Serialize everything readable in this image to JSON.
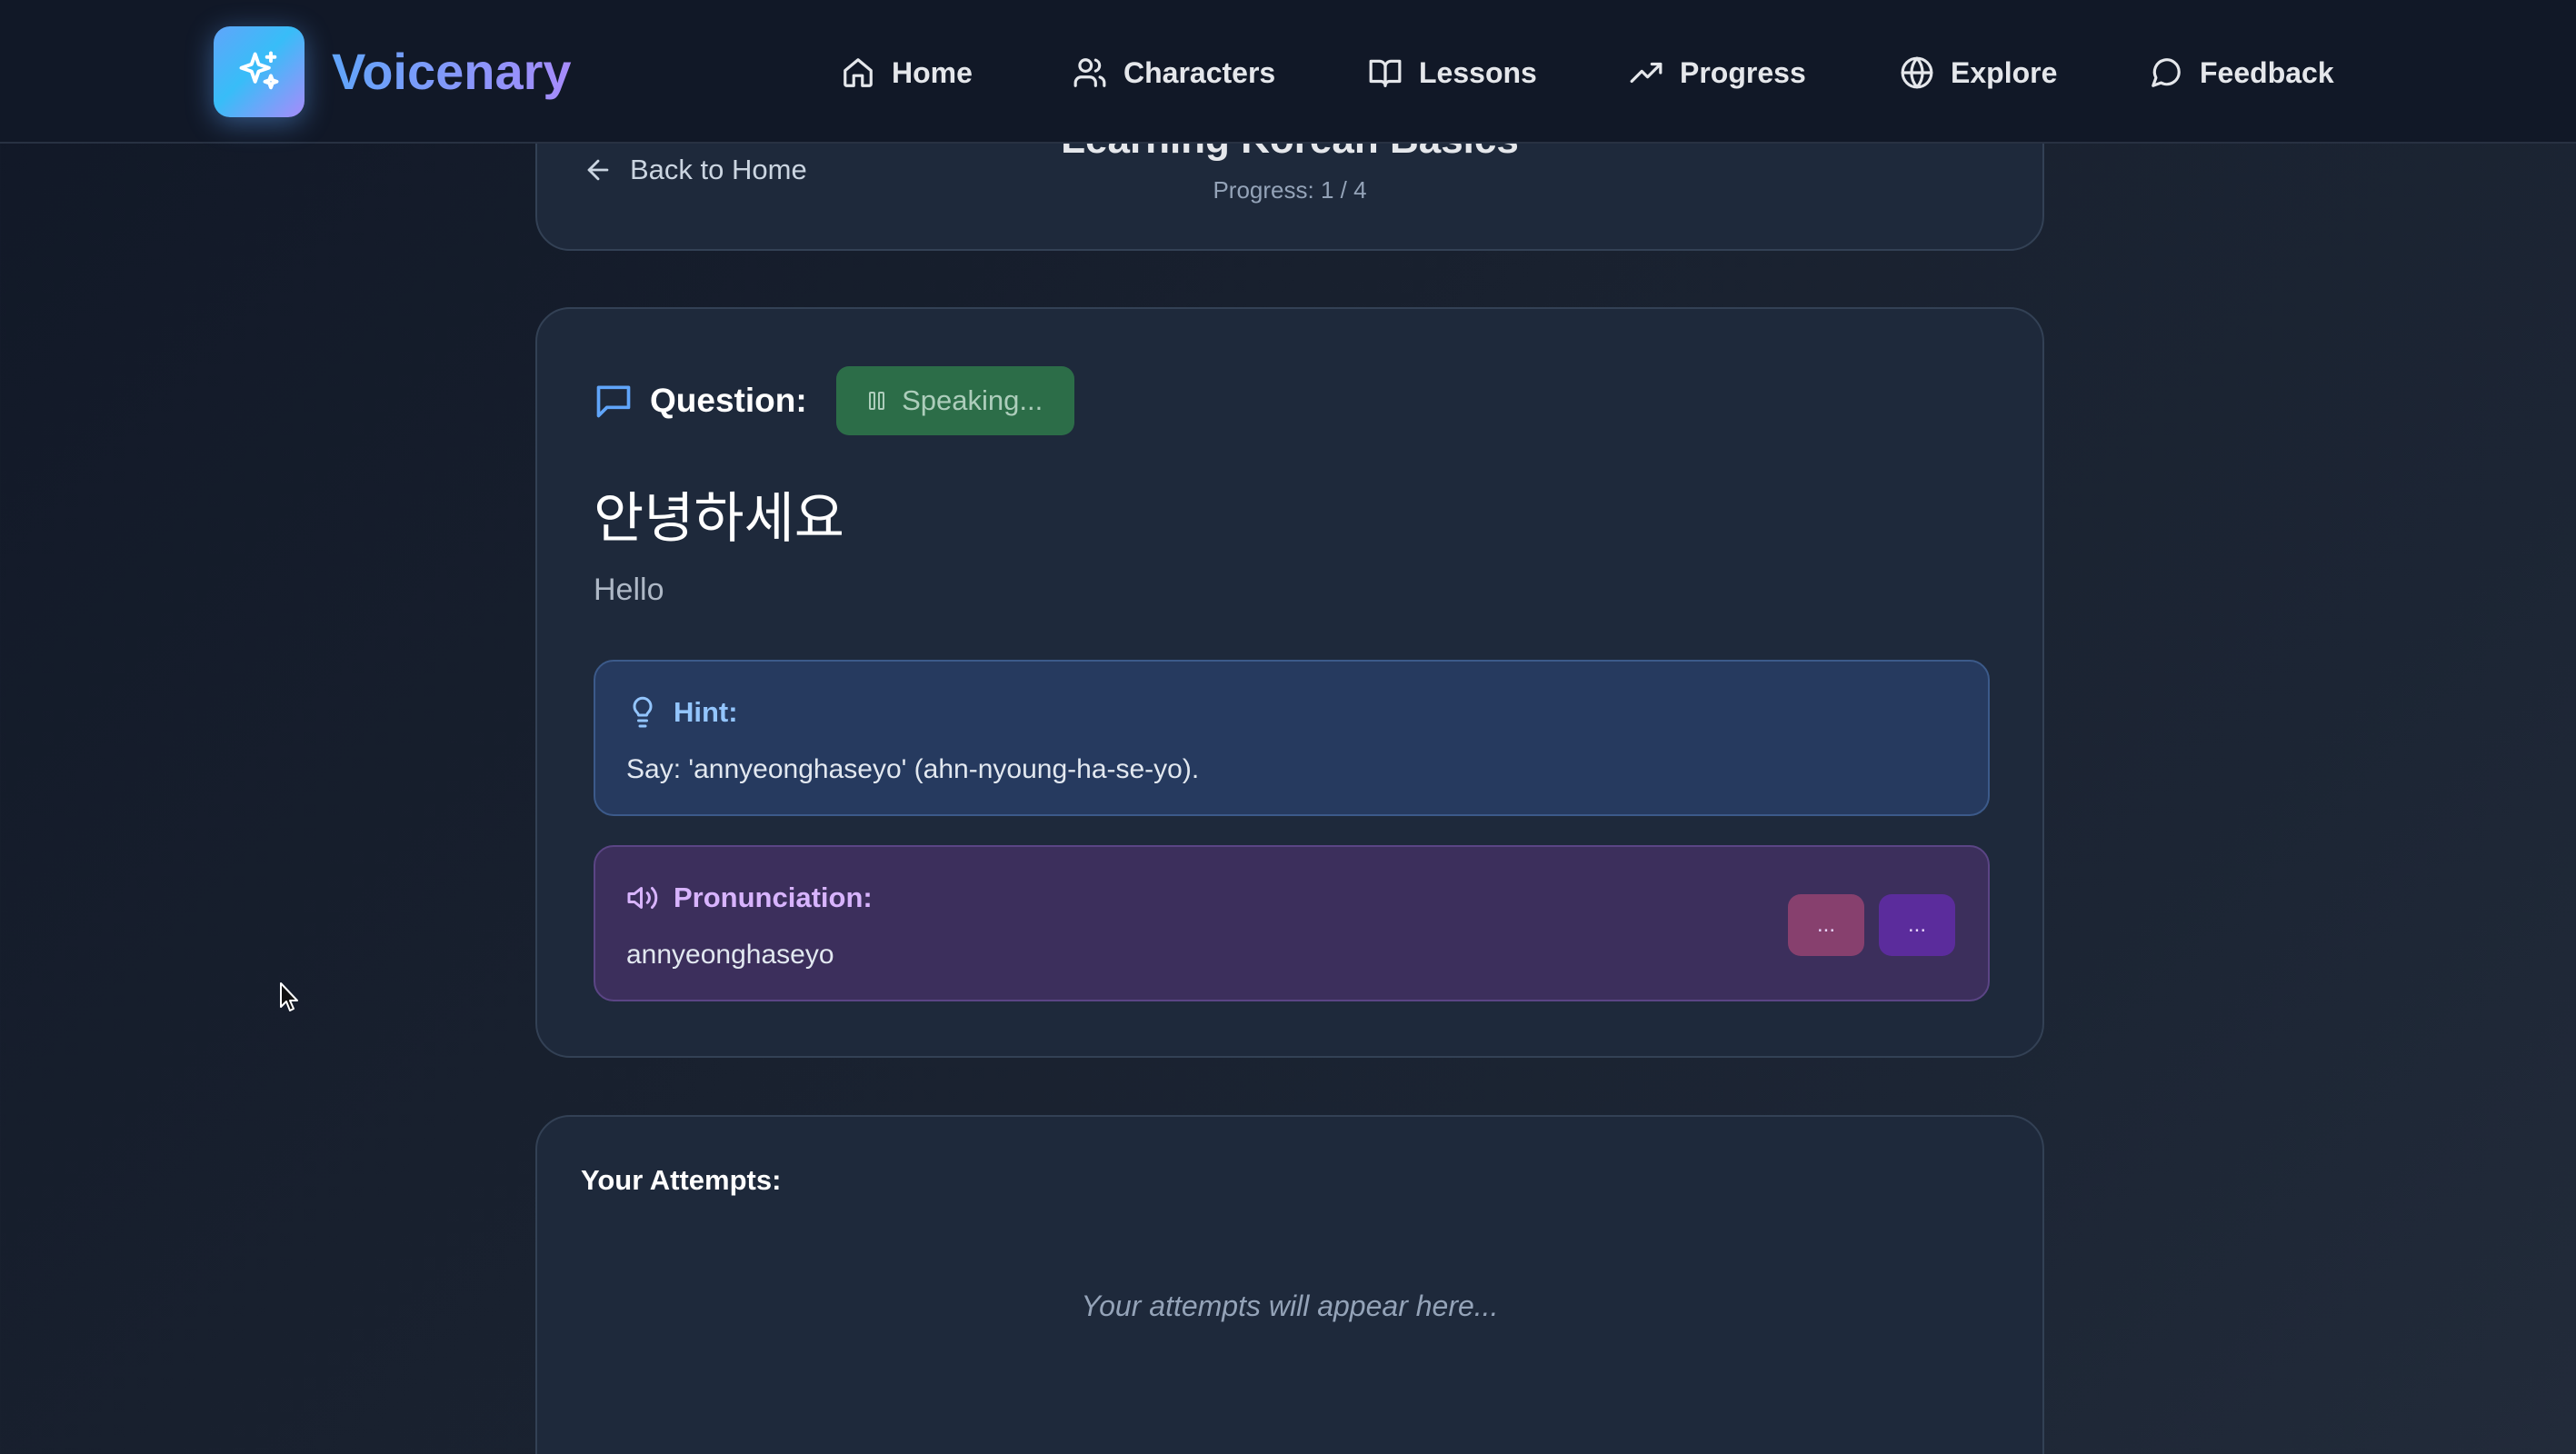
{
  "app": {
    "brand": "Voicenary",
    "brand_gradient": [
      "#60a5fa",
      "#a78bfa"
    ]
  },
  "nav": {
    "items": [
      {
        "label": "Home",
        "icon": "home-icon"
      },
      {
        "label": "Characters",
        "icon": "users-icon"
      },
      {
        "label": "Lessons",
        "icon": "book-open-icon"
      },
      {
        "label": "Progress",
        "icon": "trending-up-icon"
      },
      {
        "label": "Explore",
        "icon": "globe-icon"
      },
      {
        "label": "Feedback",
        "icon": "message-circle-icon"
      }
    ]
  },
  "lesson": {
    "back_label": "Back to Home",
    "title": "Learning Korean Basics",
    "progress_text": "Progress: 1 / 4"
  },
  "question": {
    "label": "Question:",
    "speaking_label": "Speaking...",
    "korean_text": "안녕하세요",
    "translation": "Hello"
  },
  "hint": {
    "title": "Hint:",
    "text": "Say: 'annyeonghaseyo' (ahn-nyoung-ha-se-yo)."
  },
  "pronunciation": {
    "title": "Pronunciation:",
    "text": "annyeonghaseyo",
    "button_1_label": "...",
    "button_2_label": "..."
  },
  "attempts": {
    "title": "Your Attempts:",
    "empty_text": "Your attempts will appear here..."
  },
  "colors": {
    "background": "#1a2230",
    "card": "#1e293b",
    "speaking_button": "#2f7a4b",
    "hint_bg": "#263a5f",
    "pronunciation_bg": "#3c2f5c"
  }
}
